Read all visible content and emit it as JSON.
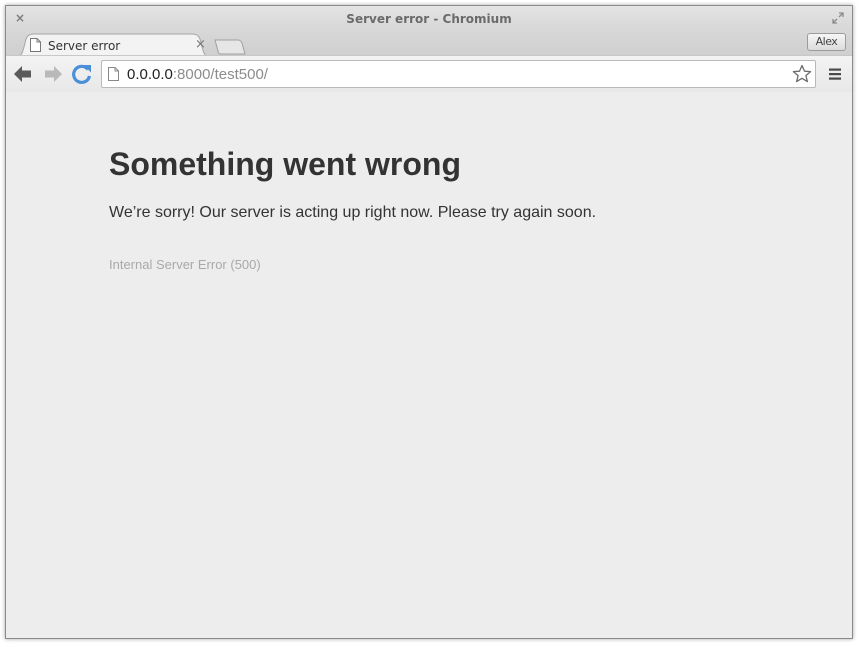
{
  "window": {
    "title": "Server error - Chromium",
    "close_glyph": "×"
  },
  "tabs": [
    {
      "title": "Server error",
      "icon": "page-icon",
      "close_glyph": "×"
    }
  ],
  "profile": {
    "label": "Alex"
  },
  "toolbar": {
    "url_host": "0.0.0.0",
    "url_rest": ":8000/test500/",
    "icons": [
      "back-arrow-icon",
      "forward-arrow-icon",
      "reload-icon",
      "page-icon",
      "star-icon",
      "menu-icon"
    ]
  },
  "page": {
    "heading": "Something went wrong",
    "message": "We’re sorry! Our server is acting up right now. Please try again soon.",
    "error_code": "Internal Server Error (500)"
  },
  "colors": {
    "page_background": "#ededed",
    "heading_text": "#333333",
    "muted_text": "#a9a9a9",
    "reload_accent": "#4a8fd8"
  }
}
